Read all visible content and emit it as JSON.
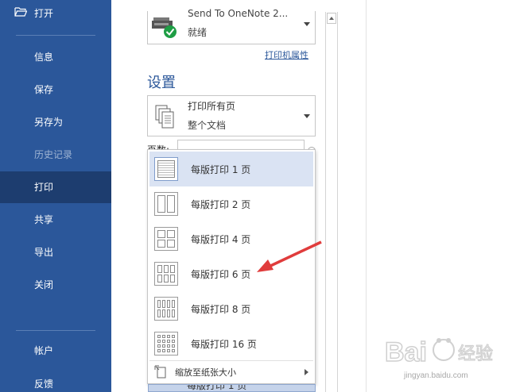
{
  "nav": {
    "open_label": "打开",
    "items": [
      {
        "label": "信息",
        "state": "normal"
      },
      {
        "label": "保存",
        "state": "normal"
      },
      {
        "label": "另存为",
        "state": "normal"
      },
      {
        "label": "历史记录",
        "state": "disabled"
      },
      {
        "label": "打印",
        "state": "active"
      },
      {
        "label": "共享",
        "state": "normal"
      },
      {
        "label": "导出",
        "state": "normal"
      },
      {
        "label": "关闭",
        "state": "normal"
      }
    ],
    "bottom_items": [
      {
        "label": "帐户"
      },
      {
        "label": "反馈"
      }
    ]
  },
  "printer": {
    "name": "Send To OneNote 2...",
    "status": "就绪",
    "properties_link": "打印机属性"
  },
  "settings": {
    "title": "设置",
    "range_title": "打印所有页",
    "range_sub": "整个文档",
    "pages_label": "页数:"
  },
  "pages_per_sheet_menu": {
    "options": [
      {
        "label": "每版打印 1 页",
        "cols": 1,
        "rows": 1,
        "selected": true
      },
      {
        "label": "每版打印 2 页",
        "cols": 2,
        "rows": 1,
        "selected": false
      },
      {
        "label": "每版打印 4 页",
        "cols": 2,
        "rows": 2,
        "selected": false
      },
      {
        "label": "每版打印 6 页",
        "cols": 3,
        "rows": 2,
        "selected": false
      },
      {
        "label": "每版打印 8 页",
        "cols": 4,
        "rows": 2,
        "selected": false
      },
      {
        "label": "每版打印 16 页",
        "cols": 4,
        "rows": 4,
        "selected": false
      }
    ],
    "scale_label": "缩放至纸张大小",
    "current_value": "每版打印 1 页"
  },
  "watermark": {
    "brand": "Bai 经验",
    "url": "jingyan.baidu.com"
  },
  "colors": {
    "nav_bg": "#2b579a",
    "nav_active": "#1d3d6f",
    "accent": "#2b579a",
    "arrow": "#e03c3c",
    "selected_bg": "#dae3f3"
  }
}
